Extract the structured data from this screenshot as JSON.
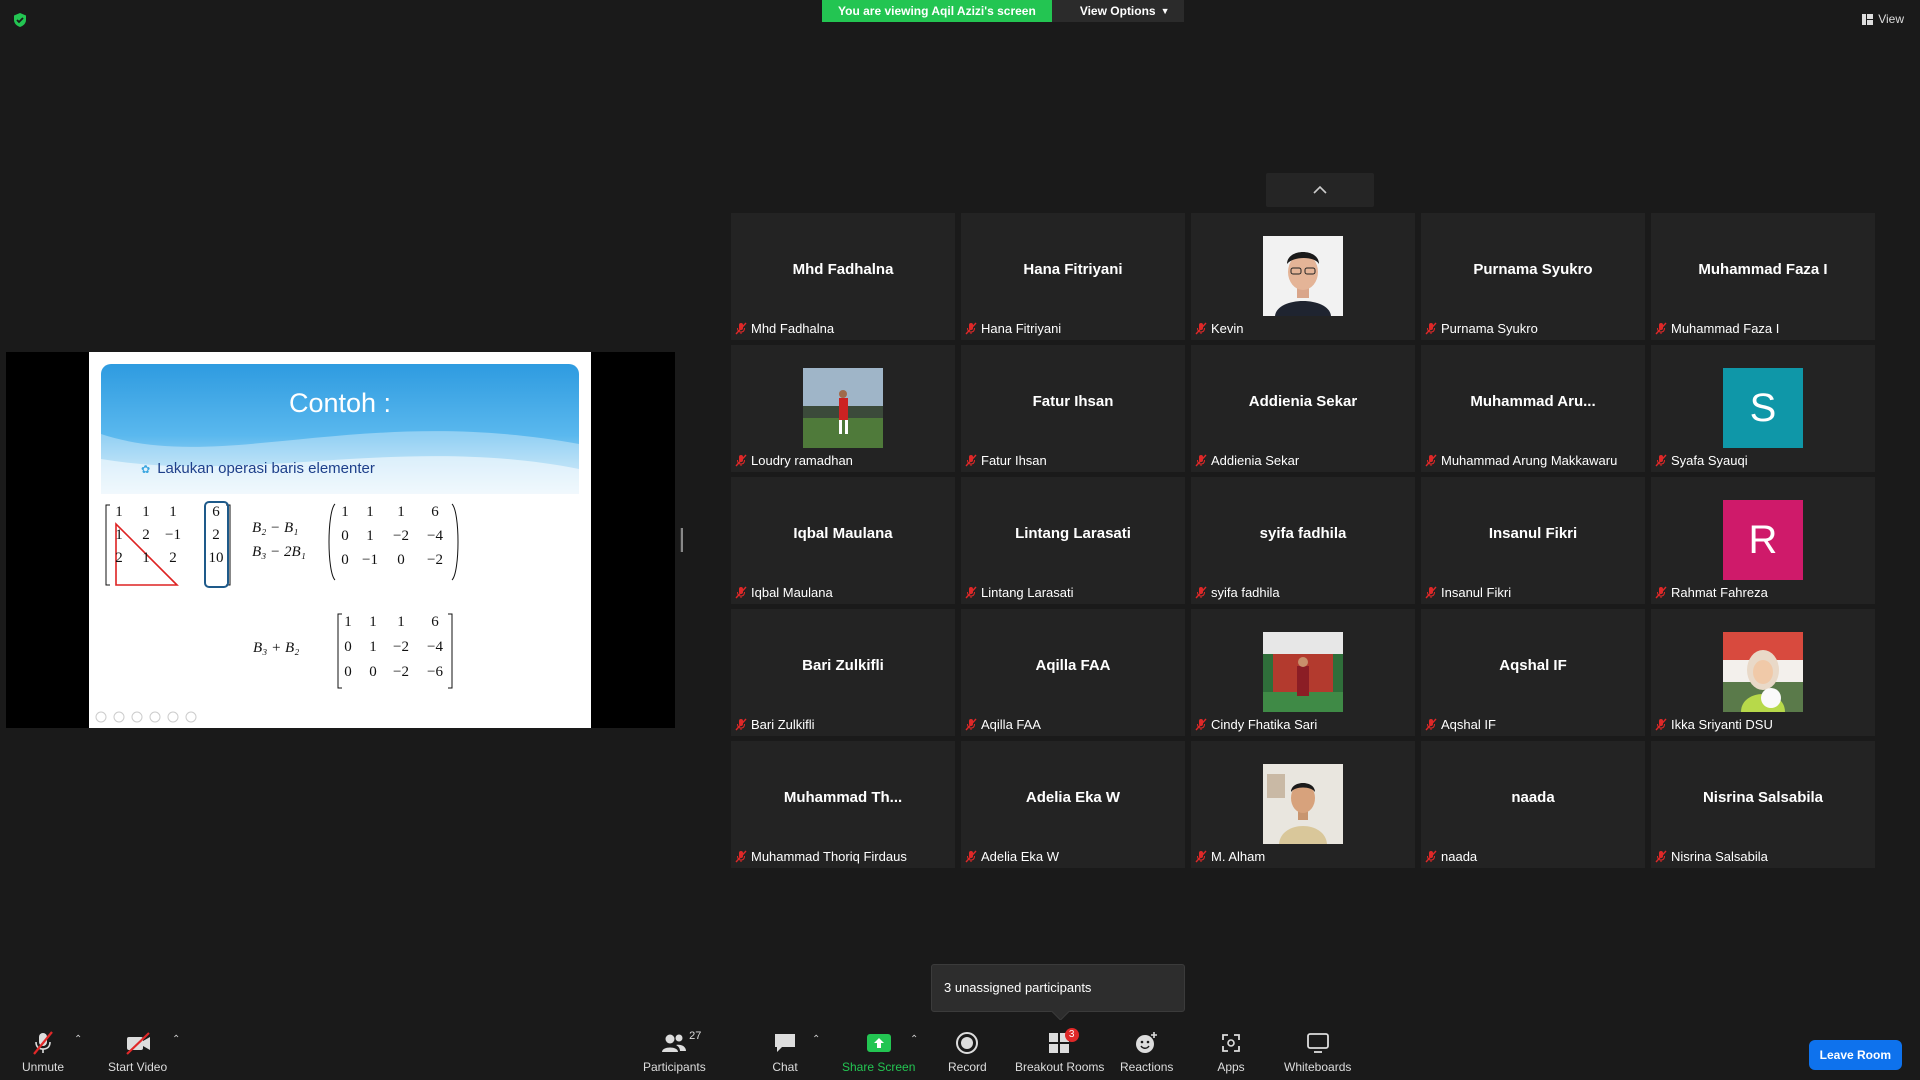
{
  "top": {
    "viewing_banner": "You are viewing Aqil Azizi's screen",
    "view_options": "View Options",
    "view_button": "View"
  },
  "slide": {
    "title": "Contoh :",
    "bullet": "Lakukan operasi baris elementer",
    "matrix_a": [
      [
        "1",
        "1",
        "1",
        "6"
      ],
      [
        "1",
        "2",
        "−1",
        "2"
      ],
      [
        "2",
        "1",
        "2",
        "10"
      ]
    ],
    "ops": [
      "B₂ − B₁",
      "B₃ − 2B₁"
    ],
    "matrix_b": [
      [
        "1",
        "1",
        "1",
        "6"
      ],
      [
        "0",
        "1",
        "−2",
        "−4"
      ],
      [
        "0",
        "−1",
        "0",
        "−2"
      ]
    ],
    "op2": "B₃ + B₂",
    "matrix_c": [
      [
        "1",
        "1",
        "1",
        "6"
      ],
      [
        "0",
        "1",
        "−2",
        "−4"
      ],
      [
        "0",
        "0",
        "−2",
        "−6"
      ]
    ]
  },
  "gallery": {
    "tiles": [
      {
        "name": "Mhd Fadhalna",
        "label": "Mhd Fadhalna"
      },
      {
        "name": "Hana Fitriyani",
        "label": "Hana Fitriyani"
      },
      {
        "name": "",
        "label": "Kevin",
        "photo": "kevin"
      },
      {
        "name": "Purnama Syukro",
        "label": "Purnama Syukro"
      },
      {
        "name": "Muhammad Faza I",
        "label": "Muhammad Faza I"
      },
      {
        "name": "",
        "label": "Loudry ramadhan",
        "photo": "field"
      },
      {
        "name": "Fatur Ihsan",
        "label": "Fatur Ihsan"
      },
      {
        "name": "Addienia Sekar",
        "label": "Addienia Sekar"
      },
      {
        "name": "Muhammad  Aru...",
        "label": "Muhammad Arung Makkawaru"
      },
      {
        "name": "",
        "label": "Syafa Syauqi",
        "avatar": "S",
        "avatar_color": "#0f97a8"
      },
      {
        "name": "Iqbal Maulana",
        "label": "Iqbal Maulana"
      },
      {
        "name": "Lintang Larasati",
        "label": "Lintang Larasati"
      },
      {
        "name": "syifa fadhila",
        "label": "syifa fadhila"
      },
      {
        "name": "Insanul Fikri",
        "label": "Insanul Fikri"
      },
      {
        "name": "",
        "label": "Rahmat Fahreza",
        "avatar": "R",
        "avatar_color": "#cf1a6a"
      },
      {
        "name": "Bari Zulkifli",
        "label": "Bari Zulkifli"
      },
      {
        "name": "Aqilla FAA",
        "label": "Aqilla FAA"
      },
      {
        "name": "",
        "label": "Cindy Fhatika Sari",
        "photo": "garden"
      },
      {
        "name": "Aqshal IF",
        "label": "Aqshal IF"
      },
      {
        "name": "",
        "label": "Ikka Sriyanti DSU",
        "photo": "hijab"
      },
      {
        "name": "Muhammad  Th...",
        "label": "Muhammad Thoriq Firdaus"
      },
      {
        "name": "Adelia Eka W",
        "label": "Adelia Eka W"
      },
      {
        "name": "",
        "label": "M. Alham",
        "photo": "alham"
      },
      {
        "name": "naada",
        "label": "naada"
      },
      {
        "name": "Nisrina Salsabila",
        "label": "Nisrina Salsabila"
      }
    ]
  },
  "popup": {
    "unassigned": "3 unassigned participants"
  },
  "toolbar": {
    "unmute": "Unmute",
    "start_video": "Start Video",
    "participants": "Participants",
    "participants_count": "27",
    "chat": "Chat",
    "share_screen": "Share Screen",
    "record": "Record",
    "breakout_rooms": "Breakout Rooms",
    "breakout_badge": "3",
    "reactions": "Reactions",
    "apps": "Apps",
    "whiteboards": "Whiteboards",
    "leave_room": "Leave Room"
  },
  "colors": {
    "green": "#23c552",
    "leave_blue": "#0e72ed",
    "mute_red": "#e02828",
    "tile_bg": "#232323"
  }
}
